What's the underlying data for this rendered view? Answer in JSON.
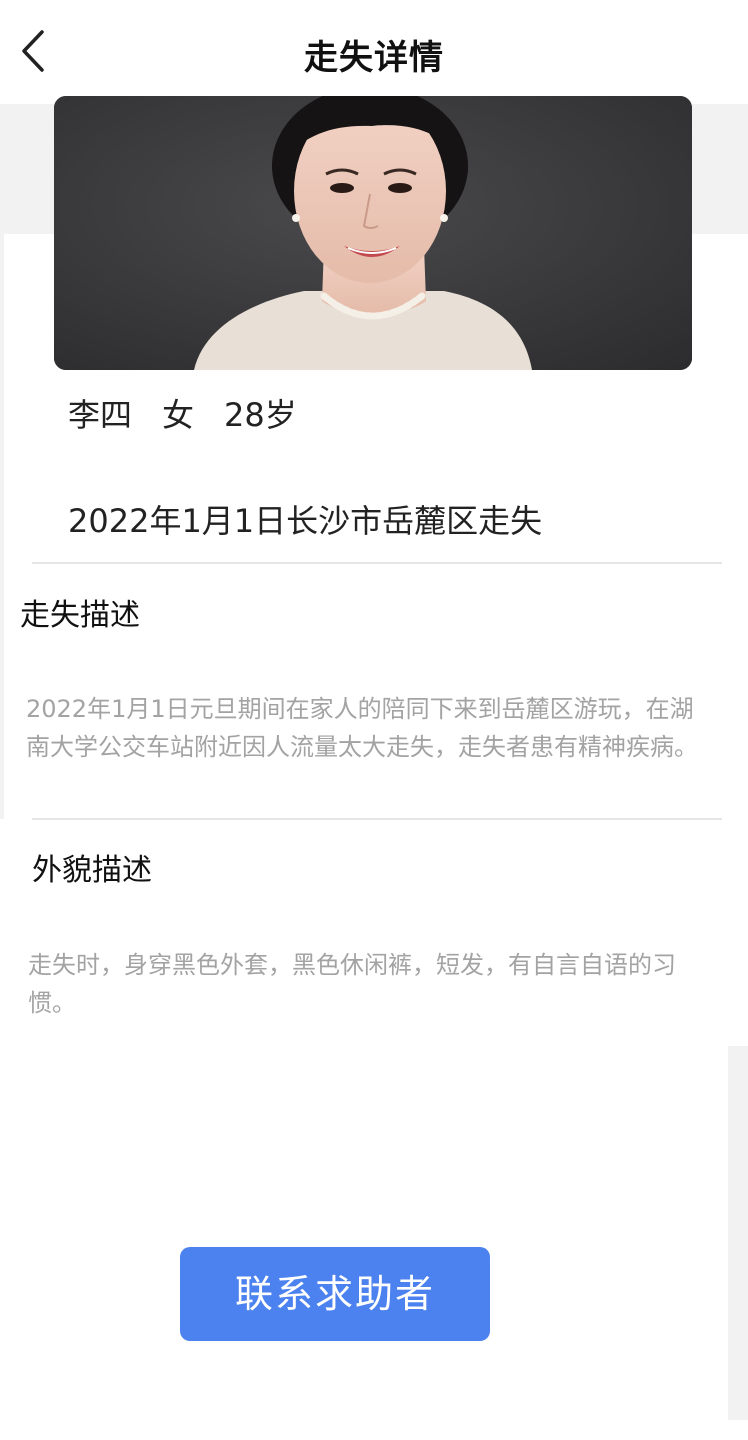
{
  "header": {
    "title": "走失详情"
  },
  "person": {
    "name": "李四",
    "gender": "女",
    "age": "28岁",
    "lost_info": "2022年1月1日长沙市岳麓区走失"
  },
  "sections": {
    "lost_description": {
      "title": "走失描述",
      "body": "2022年1月1日元旦期间在家人的陪同下来到岳麓区游玩，在湖南大学公交车站附近因人流量太大走失，走失者患有精神疾病。"
    },
    "appearance_description": {
      "title": "外貌描述",
      "body": "走失时，身穿黑色外套，黑色休闲裤，短发，有自言自语的习惯。"
    }
  },
  "actions": {
    "contact_label": "联系求助者"
  },
  "colors": {
    "accent": "#4c82ef",
    "muted_text": "#a3a3a3",
    "background_band": "#f2f2f2"
  },
  "icons": {
    "back": "chevron-left-icon"
  }
}
